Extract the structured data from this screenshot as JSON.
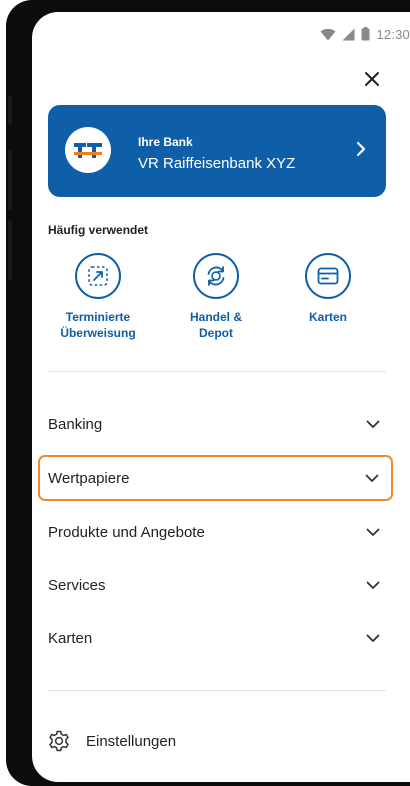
{
  "status_bar": {
    "time": "12:30"
  },
  "bank_card": {
    "subtitle": "Ihre Bank",
    "name": "VR Raiffeisenbank XYZ"
  },
  "frequently_used": {
    "title": "Häufig verwendet",
    "items": [
      {
        "line1": "Terminierte",
        "line2": "Überweisung",
        "icon": "scheduled-transfer-icon"
      },
      {
        "line1": "Handel &",
        "line2": "Depot",
        "icon": "exchange-icon"
      },
      {
        "line1": "Karten",
        "line2": "",
        "icon": "card-icon"
      }
    ]
  },
  "menu": {
    "items": [
      {
        "label": "Banking"
      },
      {
        "label": "Wertpapiere",
        "highlighted": true
      },
      {
        "label": "Produkte und Angebote"
      },
      {
        "label": "Services"
      },
      {
        "label": "Karten"
      }
    ]
  },
  "settings": {
    "label": "Einstellungen",
    "icon": "gear-icon"
  },
  "colors": {
    "brand_blue": "#0e5ea8",
    "logo_orange": "#f07e1a",
    "highlight_orange": "#f08a2c"
  }
}
